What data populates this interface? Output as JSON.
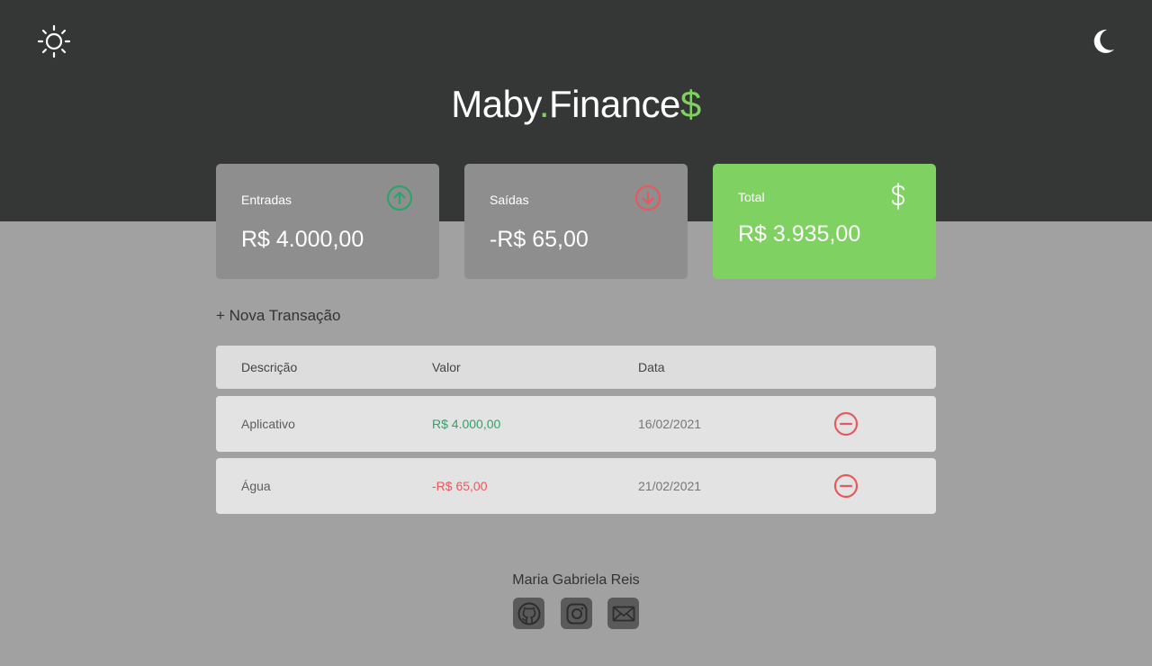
{
  "header": {
    "logo": {
      "main": "Maby",
      "dot": ".",
      "rest": "Finance",
      "dollar": "$"
    },
    "light_theme_icon": "sun-icon",
    "dark_theme_icon": "moon-icon"
  },
  "summary": {
    "income": {
      "label": "Entradas",
      "amount": "R$ 4.000,00",
      "icon": "arrow-up-circle-icon"
    },
    "expense": {
      "label": "Saídas",
      "amount": "-R$ 65,00",
      "icon": "arrow-down-circle-icon"
    },
    "total": {
      "label": "Total",
      "amount": "R$ 3.935,00",
      "icon": "dollar-icon"
    }
  },
  "actions": {
    "new_transaction": "+ Nova Transação"
  },
  "table": {
    "headers": [
      "Descrição",
      "Valor",
      "Data"
    ],
    "rows": [
      {
        "description": "Aplicativo",
        "value": "R$ 4.000,00",
        "date": "16/02/2021",
        "type": "income"
      },
      {
        "description": "Água",
        "value": "-R$ 65,00",
        "date": "21/02/2021",
        "type": "expense"
      }
    ]
  },
  "footer": {
    "author": "Maria Gabriela Reis",
    "links": [
      "github-icon",
      "instagram-icon",
      "mail-icon"
    ]
  },
  "colors": {
    "header_bg": "#353737",
    "page_bg": "#a1a1a1",
    "card_bg": "#8e8e8e",
    "accent_green": "#7fd161",
    "income_green": "#2fa36a",
    "expense_red": "#e35b60"
  }
}
